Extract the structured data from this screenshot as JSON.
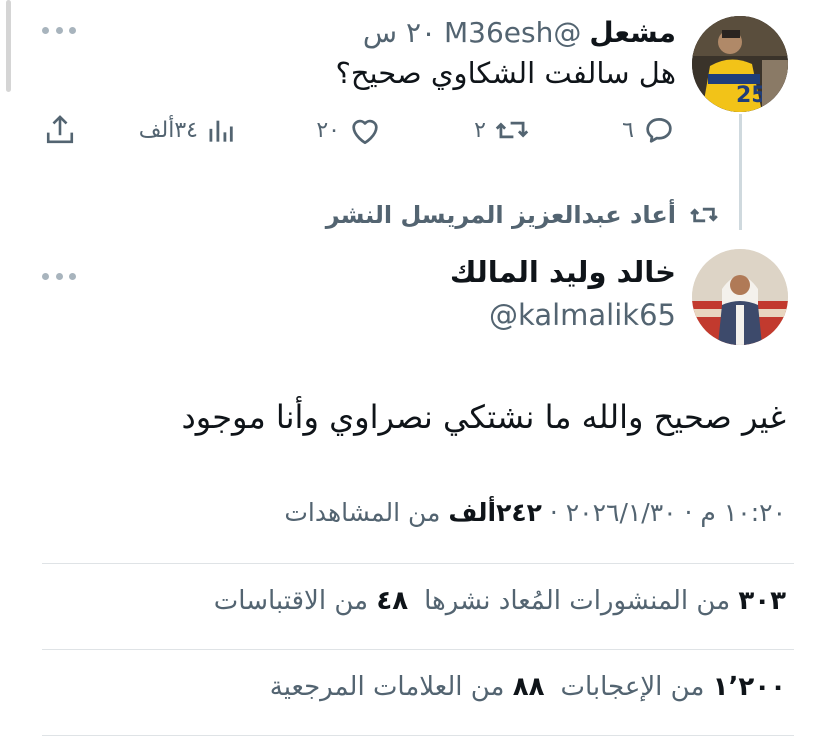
{
  "quoted_tweet": {
    "name": "مشعل",
    "handle": "@M36esh",
    "time": "٢٠ س",
    "text": "هل سالفت الشكاوي صحيح؟",
    "replies": "٦",
    "reposts": "٢",
    "likes": "٢٠",
    "views": "٣٤ألف"
  },
  "retweet_banner": {
    "label": "أعاد عبدالعزيز المريسل النشر"
  },
  "main_tweet": {
    "name": "خالد وليد المالك",
    "handle": "@kalmalik65",
    "text": "غير صحيح والله ما نشتكي نصراوي وأنا موجود",
    "timestamp": "١٠:٢٠ م · ٢٠٢٦/١/٣٠",
    "separator": " · ",
    "views_count": "٢٤٢ألف",
    "views_label": " من المشاهدات",
    "reposts_count": "٣٠٣",
    "reposts_label": " من المنشورات المُعاد نشرها",
    "quotes_count": "٤٨",
    "quotes_label": " من الاقتباسات",
    "likes_count": "١٬٢٠٠",
    "likes_label": " من الإعجابات",
    "bookmarks_count": "٨٨",
    "bookmarks_label": " من العلامات المرجعية"
  },
  "icons": {
    "more": "more-dots-icon",
    "reply": "reply-icon",
    "repost": "repost-icon",
    "like": "heart-icon",
    "views": "analytics-bars-icon",
    "share": "share-icon"
  },
  "colors": {
    "text_primary": "#0f1419",
    "text_secondary": "#536471",
    "thread_line": "#cfd9de",
    "divider": "#dfe3e6"
  }
}
